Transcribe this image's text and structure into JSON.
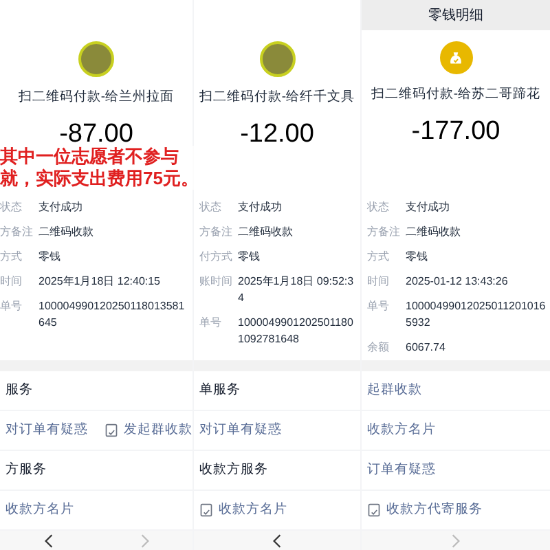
{
  "annotation": "其中一位志愿者不参与就，实际支出费用75元。",
  "panels": [
    {
      "avatar": {
        "kind": "photo"
      },
      "merchant": "扫二维码付款-给兰州拉面",
      "amount": "-87.00",
      "details": [
        {
          "label": "状态",
          "value": "支付成功"
        },
        {
          "label": "方备注",
          "value": "二维码收款"
        },
        {
          "label": "方式",
          "value": "零钱"
        },
        {
          "label": "时间",
          "value": "2025年1月18日 12:40:15"
        },
        {
          "label": "单号",
          "value": "100004990120250118013581645"
        }
      ],
      "services": [
        {
          "kind": "heading",
          "items": [
            {
              "label": "服务",
              "icon": false
            }
          ]
        },
        {
          "kind": "action",
          "items": [
            {
              "label": "对订单有疑惑",
              "icon": false
            },
            {
              "label": "发起群收款",
              "icon": true
            }
          ]
        },
        {
          "kind": "heading",
          "items": [
            {
              "label": "方服务",
              "icon": false
            }
          ]
        },
        {
          "kind": "action",
          "items": [
            {
              "label": "收款方名片",
              "icon": false
            }
          ]
        }
      ],
      "nav": [
        {
          "kind": "back"
        },
        {
          "kind": "forward"
        }
      ]
    },
    {
      "avatar": {
        "kind": "photo"
      },
      "merchant": "扫二维码付款-给纤千文具",
      "amount": "-12.00",
      "details": [
        {
          "label": "状态",
          "value": "支付成功"
        },
        {
          "label": "方备注",
          "value": "二维码收款"
        },
        {
          "label": "付方式",
          "value": "零钱"
        },
        {
          "label": "账时间",
          "value": "2025年1月18日 09:52:34"
        },
        {
          "label": "单号",
          "value": "10000499012025011801092781648"
        }
      ],
      "services": [
        {
          "kind": "heading",
          "items": [
            {
              "label": "单服务",
              "icon": false
            }
          ]
        },
        {
          "kind": "action",
          "items": [
            {
              "label": "对订单有疑惑",
              "icon": false
            }
          ]
        },
        {
          "kind": "heading",
          "items": [
            {
              "label": "收款方服务",
              "icon": false
            }
          ]
        },
        {
          "kind": "action",
          "items": [
            {
              "label": "收款方名片",
              "icon": true
            }
          ]
        }
      ],
      "nav": [
        {
          "kind": "back"
        }
      ]
    },
    {
      "title": "零钱明细",
      "avatar": {
        "kind": "wallet"
      },
      "merchant": "扫二维码付款-给苏二哥蹄花",
      "amount": "-177.00",
      "details": [
        {
          "label": "状态",
          "value": "支付成功"
        },
        {
          "label": "方备注",
          "value": "二维码收款"
        },
        {
          "label": "方式",
          "value": "零钱"
        },
        {
          "label": "时间",
          "value": "2025-01-12 13:43:26"
        },
        {
          "label": "单号",
          "value": "100004990120250112010165932"
        },
        {
          "label": "余额",
          "value": "6067.74"
        }
      ],
      "services": [
        {
          "kind": "action",
          "items": [
            {
              "label": "起群收款",
              "icon": false
            }
          ]
        },
        {
          "kind": "action",
          "items": [
            {
              "label": "收款方名片",
              "icon": false
            }
          ]
        },
        {
          "kind": "action",
          "items": [
            {
              "label": "订单有疑惑",
              "icon": false
            }
          ]
        },
        {
          "kind": "action",
          "items": [
            {
              "label": "收款方代寄服务",
              "icon": true
            }
          ]
        }
      ],
      "nav": [
        {
          "kind": "forward"
        }
      ]
    }
  ]
}
